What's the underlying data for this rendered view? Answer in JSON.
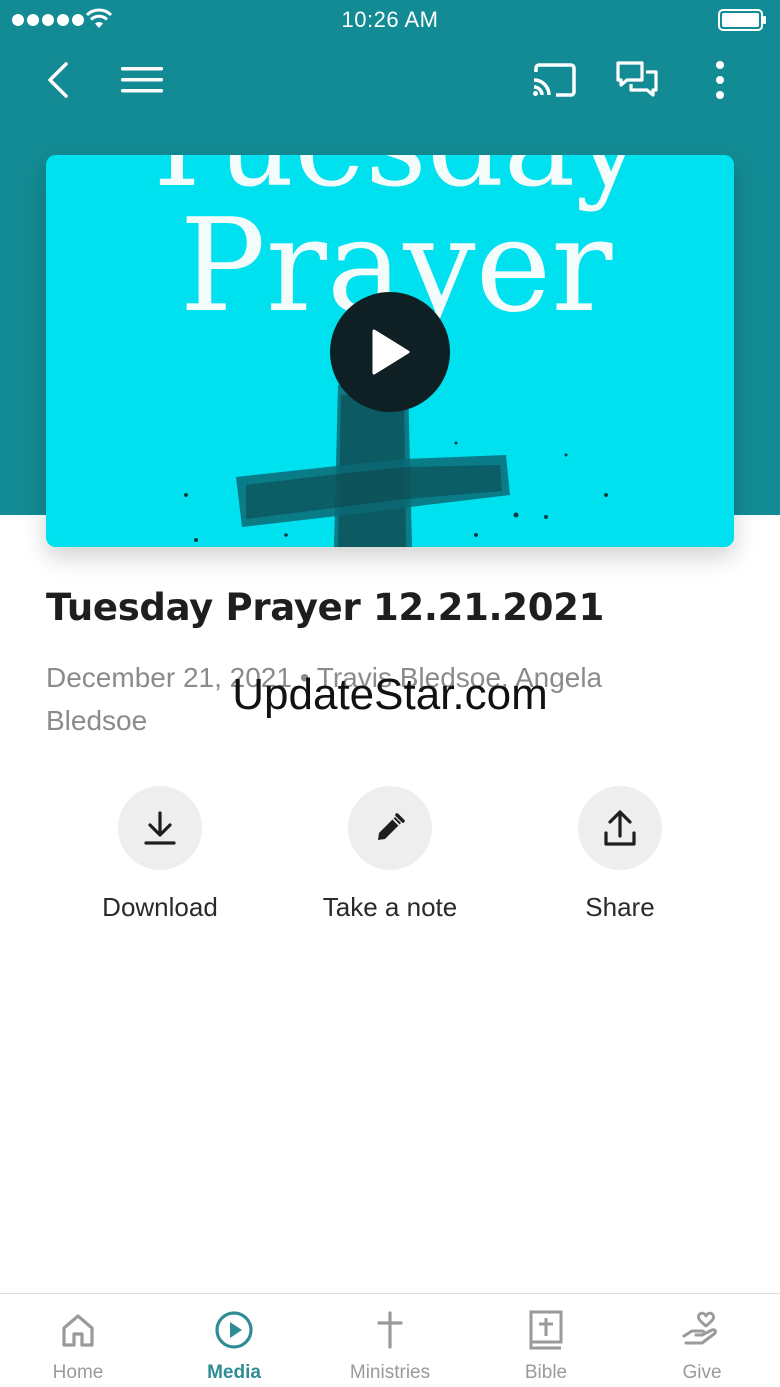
{
  "status_bar": {
    "time": "10:26 AM"
  },
  "top_nav": {
    "back_icon": "chevron-left-icon",
    "menu_icon": "hamburger-icon",
    "cast_icon": "cast-icon",
    "chat_icon": "chat-bubbles-icon",
    "more_icon": "more-vertical-icon"
  },
  "hero": {
    "artwork_text_line1": "Tuesday",
    "artwork_text_line2": "Prayer",
    "play_icon": "play-icon"
  },
  "sermon": {
    "title": "Tuesday Prayer 12.21.2021",
    "meta": "December 21, 2021 • Travis Bledsoe, Angela Bledsoe"
  },
  "watermark": "UpdateStar.com",
  "actions": [
    {
      "label": "Download",
      "icon": "download-icon"
    },
    {
      "label": "Take a note",
      "icon": "pencil-icon"
    },
    {
      "label": "Share",
      "icon": "share-icon"
    }
  ],
  "tabs": [
    {
      "label": "Home",
      "icon": "home-icon",
      "active": false
    },
    {
      "label": "Media",
      "icon": "play-circle-icon",
      "active": true
    },
    {
      "label": "Ministries",
      "icon": "cross-icon",
      "active": false
    },
    {
      "label": "Bible",
      "icon": "bible-icon",
      "active": false
    },
    {
      "label": "Give",
      "icon": "give-hand-heart-icon",
      "active": false
    }
  ],
  "colors": {
    "header_teal": "#138b94",
    "artwork_cyan": "#00e1ef",
    "active_tab": "#2f8c96",
    "inactive_tab": "#9a9a9a"
  }
}
